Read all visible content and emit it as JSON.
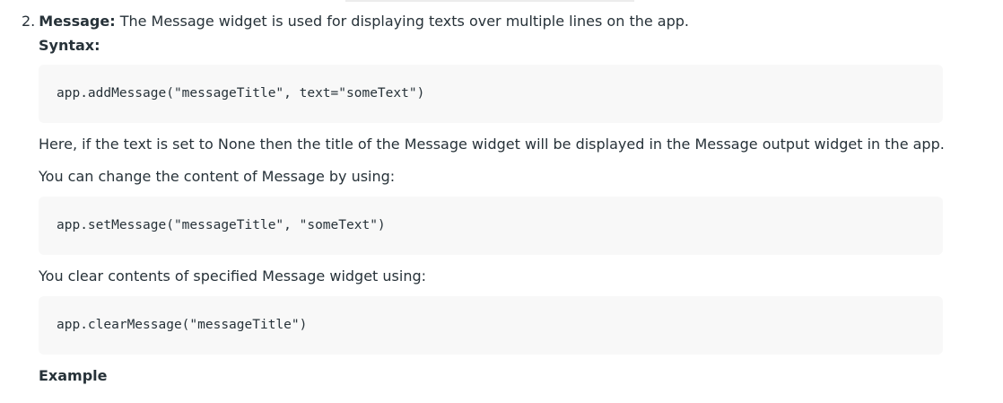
{
  "list_item": {
    "number": "2.",
    "term": "Message:",
    "description": "The Message widget is used for displaying texts over multiple lines on the app."
  },
  "syntax_label": "Syntax:",
  "code_blocks": [
    "app.addMessage(\"messageTitle\", text=\"someText\")",
    "app.setMessage(\"messageTitle\", \"someText\")",
    "app.clearMessage(\"messageTitle\")"
  ],
  "paragraphs": [
    "Here, if the text is set to None then the title of the Message widget will be displayed in the Message output widget in the app.",
    "You can change the content of Message by using:",
    "You clear contents of specified Message widget using:"
  ],
  "example_label": "Example"
}
